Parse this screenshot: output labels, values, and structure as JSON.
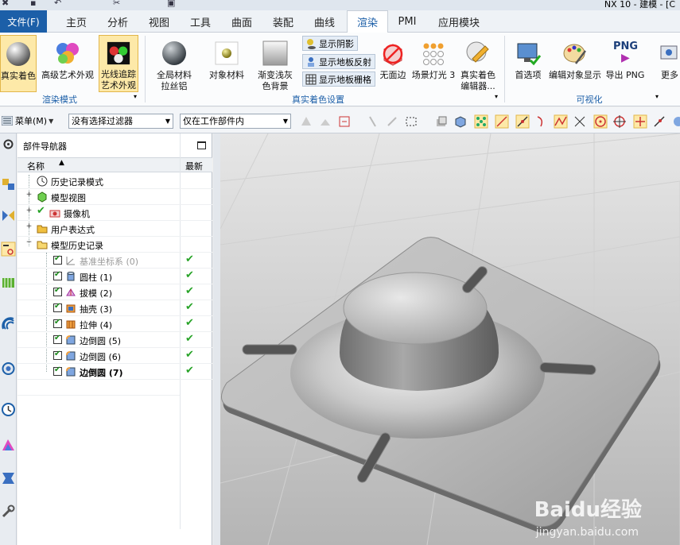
{
  "window": {
    "title": "NX 10 - 建模 - [C"
  },
  "tabs": [
    {
      "label": "文件(F)"
    },
    {
      "label": "主页"
    },
    {
      "label": "分析"
    },
    {
      "label": "视图"
    },
    {
      "label": "工具"
    },
    {
      "label": "曲面"
    },
    {
      "label": "装配"
    },
    {
      "label": "曲线"
    },
    {
      "label": "渲染"
    },
    {
      "label": "PMI"
    },
    {
      "label": "应用模块"
    }
  ],
  "ribbon": {
    "true_shading": "真实着色",
    "advanced_studio": "高级艺术外观",
    "raytrace_line1": "光线追踪",
    "raytrace_line2": "艺术外观",
    "global_material_line1": "全局材料",
    "global_material_line2": "拉丝铝",
    "object_material": "对象材料",
    "gradient_line1": "渐变浅灰",
    "gradient_line2": "色背景",
    "show_shadows": "显示阴影",
    "show_floor_reflection": "显示地板反射",
    "show_floor_grid": "显示地板栅格",
    "no_face": "无面边",
    "scene_light": "场景灯光 3",
    "true_shading_editor_line1": "真实着色",
    "true_shading_editor_line2": "编辑器...",
    "preferences": "首选项",
    "edit_object_display": "编辑对象显示",
    "export_png": "导出 PNG",
    "png_badge": "PNG",
    "more": "更多",
    "group_render_mode": "渲染模式",
    "group_true_shading_settings": "真实着色设置",
    "group_visualization": "可视化"
  },
  "selection_bar": {
    "menu": "菜单(M)",
    "filter": "没有选择过滤器",
    "scope": "仅在工作部件内"
  },
  "navigator": {
    "title": "部件导航器",
    "col_name": "名称",
    "col_latest": "最新",
    "rows": [
      {
        "label": "历史记录模式"
      },
      {
        "label": "模型视图"
      },
      {
        "label": "摄像机"
      },
      {
        "label": "用户表达式"
      },
      {
        "label": "模型历史记录"
      },
      {
        "label": "基准坐标系 (0)"
      },
      {
        "label": "圆柱 (1)"
      },
      {
        "label": "拔模 (2)"
      },
      {
        "label": "抽壳 (3)"
      },
      {
        "label": "拉伸 (4)"
      },
      {
        "label": "边倒圆 (5)"
      },
      {
        "label": "边倒圆 (6)"
      },
      {
        "label": "边倒圆 (7)"
      }
    ],
    "latest_mark": "✔"
  },
  "watermark": {
    "main": "Baidu经验",
    "sub": "jingyan.baidu.com"
  },
  "colors": {
    "accent": "#1c5fa8",
    "selected_tool": "#fde9a8",
    "check_green": "#27a327"
  }
}
